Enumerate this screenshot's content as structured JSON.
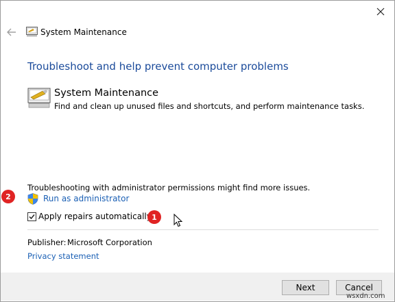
{
  "window": {
    "title": "System Maintenance",
    "close_glyph": "✕",
    "back_glyph": "←"
  },
  "main": {
    "heading": "Troubleshoot and help prevent computer problems",
    "task_title": "System Maintenance",
    "task_description": "Find and clean up unused files and shortcuts, and perform maintenance tasks."
  },
  "admin": {
    "note": "Troubleshooting with administrator permissions might find more issues.",
    "run_as_admin": "Run as administrator"
  },
  "options": {
    "apply_repairs_label": "Apply repairs automatically",
    "apply_repairs_checked": true
  },
  "annotations": {
    "badge_1": "1",
    "badge_2": "2"
  },
  "info": {
    "publisher_label": "Publisher:",
    "publisher_value": "Microsoft Corporation",
    "privacy_link": "Privacy statement"
  },
  "footer": {
    "next_label": "Next",
    "cancel_label": "Cancel"
  },
  "watermark": "wsxdn.com",
  "colors": {
    "heading": "#1a4a9a",
    "link": "#1a5fb4",
    "badge": "#e02424"
  }
}
